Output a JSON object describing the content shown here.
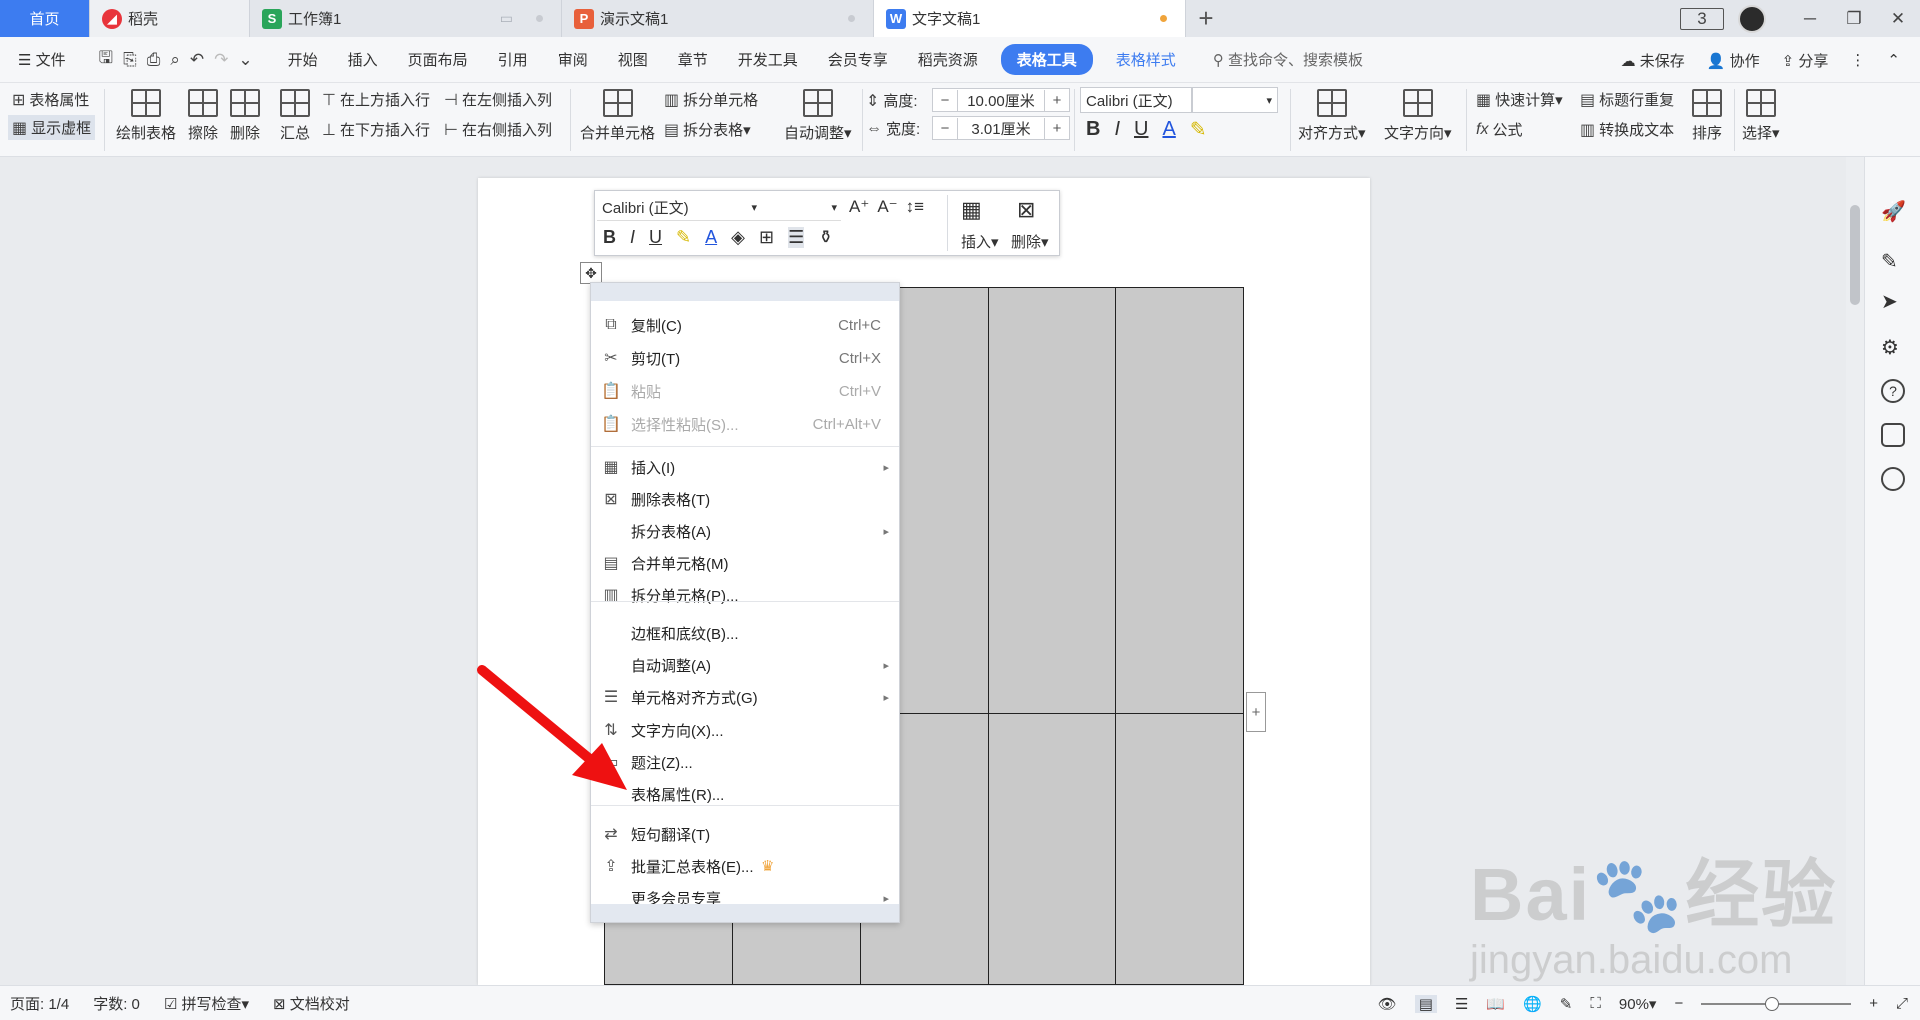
{
  "tabs": {
    "home": "首页",
    "daoke": "稻壳",
    "workbook": "工作簿1",
    "workbook_badge": "S",
    "presentation": "演示文稿1",
    "presentation_badge": "P",
    "document": "文字文稿1",
    "document_badge": "W",
    "add": "+",
    "window_count": "3"
  },
  "menubar": {
    "file": "文件",
    "items": [
      "开始",
      "插入",
      "页面布局",
      "引用",
      "审阅",
      "视图",
      "章节",
      "开发工具",
      "会员专享",
      "稻壳资源"
    ],
    "active": "表格工具",
    "table_style": "表格样式",
    "search": "查找命令、搜索模板",
    "unsaved": "未保存",
    "collab": "协作",
    "share": "分享"
  },
  "ribbon": {
    "table_props": "表格属性",
    "show_gridlines": "显示虚框",
    "draw_table": "绘制表格",
    "erase": "擦除",
    "delete": "删除",
    "summary": "汇总",
    "insert_above": "在上方插入行",
    "insert_below": "在下方插入行",
    "insert_left": "在左侧插入列",
    "insert_right": "在右侧插入列",
    "merge_cells": "合并单元格",
    "split_cells": "拆分单元格",
    "split_table": "拆分表格",
    "auto_fit": "自动调整",
    "height_label": "高度:",
    "height_value": "10.00厘米",
    "width_label": "宽度:",
    "width_value": "3.01厘米",
    "font_name": "Calibri (正文)",
    "align": "对齐方式",
    "text_direction": "文字方向",
    "quick_calc": "快速计算",
    "formula": "公式",
    "repeat_header": "标题行重复",
    "to_text": "转换成文本",
    "sort": "排序",
    "select": "选择"
  },
  "floatbar": {
    "font_name": "Calibri (正文)",
    "insert": "插入",
    "delete": "删除"
  },
  "context_menu": {
    "copy": {
      "label": "复制(C)",
      "shortcut": "Ctrl+C"
    },
    "cut": {
      "label": "剪切(T)",
      "shortcut": "Ctrl+X"
    },
    "paste": {
      "label": "粘贴",
      "shortcut": "Ctrl+V"
    },
    "paste_special": {
      "label": "选择性粘贴(S)...",
      "shortcut": "Ctrl+Alt+V"
    },
    "insert": "插入(I)",
    "delete_table": "删除表格(T)",
    "split_table": "拆分表格(A)",
    "merge_cells": "合并单元格(M)",
    "split_cells": "拆分单元格(P)...",
    "borders": "边框和底纹(B)...",
    "auto_fit": "自动调整(A)",
    "cell_align": "单元格对齐方式(G)",
    "text_direction": "文字方向(X)...",
    "caption": "题注(Z)...",
    "table_props": "表格属性(R)...",
    "translate": "短句翻译(T)",
    "batch_summary": "批量汇总表格(E)...",
    "more_member": "更多会员专享"
  },
  "watermark": {
    "brand": "Bai",
    "brand_cn": "经验",
    "url": "jingyan.baidu.com"
  },
  "status": {
    "page": "页面: 1/4",
    "words": "字数: 0",
    "spell": "拼写检查",
    "proof": "文档校对",
    "zoom": "90%",
    "zoom_level": 0.47
  },
  "colors": {
    "accent": "#3d7cf0",
    "arrow": "#ee1111",
    "cell_fill": "#c9c9c9"
  }
}
